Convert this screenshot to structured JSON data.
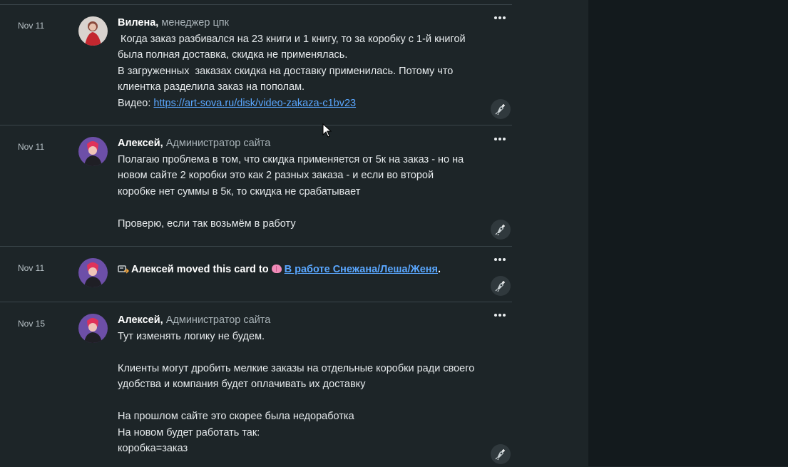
{
  "entries": [
    {
      "date": "Nov 11",
      "author": "Вилена,",
      "role": "менеджер цпк",
      "lines": [
        " Когда заказ разбивался на 23 книги и 1 книгу, то за коробку с 1-й книгой",
        "была полная доставка, скидка не применялась.",
        "В загруженных  заказах скидка на доставку применилась. Потому что",
        "клиентка разделила заказ на пополам."
      ],
      "video_label": "Видео: ",
      "video_link": "https://art-sova.ru/disk/video-zakaza-c1bv23"
    },
    {
      "date": "Nov 11",
      "author": "Алексей,",
      "role": "Администратор сайта",
      "lines": [
        "Полагаю проблема в том, что скидка применяется от 5к на заказ - но на",
        "новом сайте 2 коробки это как 2 разных заказа - и если во второй",
        "коробке нет суммы в 5к, то скидка не срабатывает",
        "",
        "Проверю, если так возьмём в работу"
      ]
    },
    {
      "date": "Nov 11",
      "action_text": "Алексей moved this card to",
      "list_name": "В работе Снежана/Леша/Женя",
      "punct": "."
    },
    {
      "date": "Nov 15",
      "author": "Алексей,",
      "role": "Администратор сайта",
      "lines": [
        "Тут изменять логику не будем.",
        "",
        "Клиенты могут дробить мелкие заказы на отдельные коробки ради своего",
        "удобства и компания будет оплачивать их доставку",
        "",
        "На прошлом сайте это скорее была недоработка",
        "На новом будет работать так:",
        "коробка=заказ"
      ]
    }
  ],
  "icons": {
    "more": "more-horizontal-icon",
    "reaction": "add-reaction-icon",
    "move": "move-card-icon",
    "list_emoji": "brain-emoji-icon"
  },
  "colors": {
    "background": "#1d2528",
    "panel": "#131a1d",
    "link": "#5aa7ff",
    "divider": "#3a454a"
  }
}
